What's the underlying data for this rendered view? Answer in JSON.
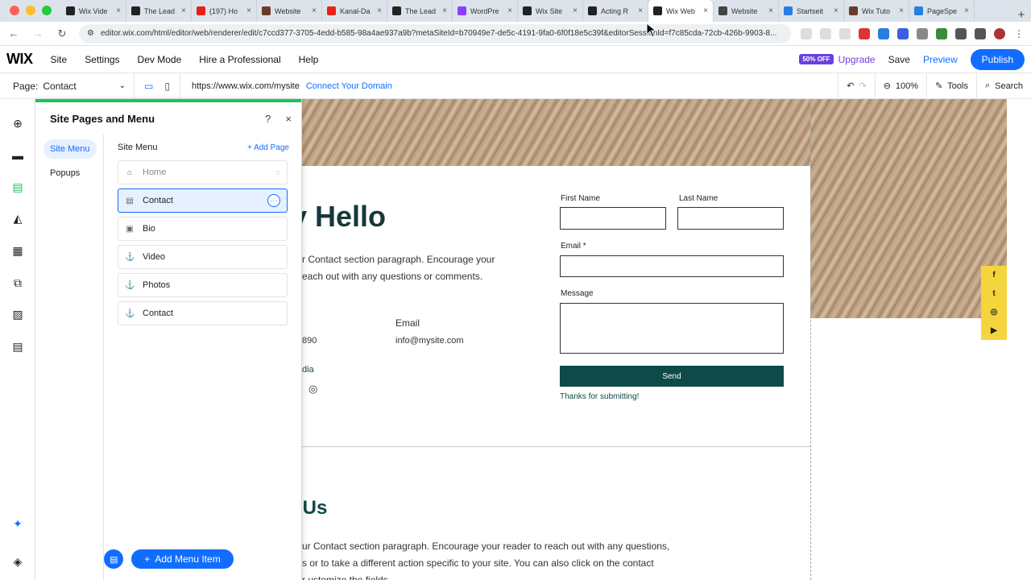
{
  "browser": {
    "tabs": [
      {
        "label": "Wix Vide",
        "color": "#222"
      },
      {
        "label": "The Lead",
        "color": "#222"
      },
      {
        "label": "(197) Ho",
        "color": "#e62117"
      },
      {
        "label": "Website",
        "color": "#6b3b2a"
      },
      {
        "label": "Kanal-Da",
        "color": "#e62117"
      },
      {
        "label": "The Lead",
        "color": "#222"
      },
      {
        "label": "WordPre",
        "color": "#8a3ffc"
      },
      {
        "label": "Wix Site",
        "color": "#222"
      },
      {
        "label": "Acting R",
        "color": "#222"
      },
      {
        "label": "Wix Web",
        "color": "#222"
      },
      {
        "label": "Website",
        "color": "#444"
      },
      {
        "label": "Startseit",
        "color": "#2a7de1"
      },
      {
        "label": "Wix Tuto",
        "color": "#6b3b2a"
      },
      {
        "label": "PageSpe",
        "color": "#2a7de1"
      }
    ],
    "new_tab": "+",
    "tab_close": "×",
    "url": "editor.wix.com/html/editor/web/renderer/edit/c7ccd377-3705-4edd-b585-98a4ae937a9b?metaSiteId=b70949e7-de5c-4191-9fa0-6f0f18e5c39f&editorSessionId=f7c85cda-72cb-426b-9903-8..."
  },
  "wixbar": {
    "logo": "WIX",
    "menu": [
      "Site",
      "Settings",
      "Dev Mode",
      "Hire a Professional",
      "Help"
    ],
    "offer_badge": "50% OFF",
    "upgrade": "Upgrade",
    "save": "Save",
    "preview": "Preview",
    "publish": "Publish"
  },
  "subbar": {
    "page_label": "Page:",
    "page_value": "Contact",
    "site_url": "https://www.wix.com/mysite",
    "connect": "Connect Your Domain",
    "zoom": "100%",
    "tools": "Tools",
    "search": "Search"
  },
  "panel": {
    "title": "Site Pages and Menu",
    "help": "?",
    "close": "×",
    "nav": [
      "Site Menu",
      "Popups"
    ],
    "section_title": "Site Menu",
    "add_page": "+ Add Page",
    "items": [
      {
        "label": "Home",
        "icon": "⌂"
      },
      {
        "label": "Contact",
        "icon": "▤"
      },
      {
        "label": "Bio",
        "icon": "▣"
      },
      {
        "label": "Video",
        "icon": "⚓"
      },
      {
        "label": "Photos",
        "icon": "⚓"
      },
      {
        "label": "Contact",
        "icon": "⚓"
      }
    ],
    "add_menu_item": "Add Menu Item"
  },
  "canvas": {
    "hello_heading": "y Hello",
    "para1_line1": "r Contact section paragraph. Encourage your",
    "para1_line2": "each out with any questions or comments.",
    "email_label": "Email",
    "email_value": "info@mysite.com",
    "phone_partial": "890",
    "social_partial": "dia",
    "form": {
      "first_name": "First Name",
      "last_name": "Last Name",
      "email": "Email *",
      "message": "Message",
      "send": "Send",
      "thanks": "Thanks for submitting!"
    },
    "contact_heading": "t Us",
    "para2_line1": "ur Contact section paragraph. Encourage your reader to reach out with any questions,",
    "para2_line2": "s or to take a different action specific to your site. You can also click on the contact",
    "para2_line3": "r ustomize the fields."
  },
  "social_bar": [
    "f",
    "t",
    "◎",
    "▶"
  ]
}
